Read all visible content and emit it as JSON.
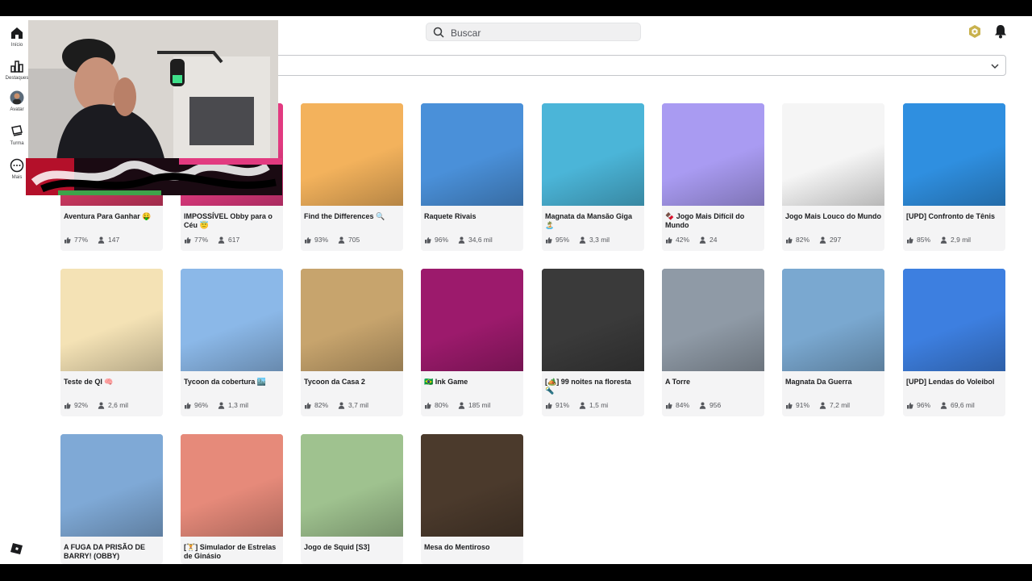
{
  "app": {
    "name": "Roblox"
  },
  "sidebar": {
    "items": [
      {
        "label": "Início",
        "icon": "home-icon"
      },
      {
        "label": "Destaques",
        "icon": "charts-icon"
      },
      {
        "label": "Avatar",
        "icon": "avatar-icon"
      },
      {
        "label": "Turma",
        "icon": "party-icon"
      },
      {
        "label": "Mais",
        "icon": "more-icon"
      }
    ]
  },
  "search": {
    "placeholder": "Buscar"
  },
  "header": {
    "robux_icon": "robux-icon",
    "notification_icon": "bell-icon"
  },
  "colors": {
    "background": "#ffffff",
    "card": "#f4f4f5",
    "text": "#1b1c1e",
    "muted": "#55575c"
  },
  "games": [
    {
      "title": "Aventura Para Ganhar 🤑",
      "rating": "77%",
      "players": "147",
      "thumb": "#d43a64"
    },
    {
      "title": "IMPOSSÍVEL Obby para o Céu 😇",
      "rating": "77%",
      "players": "617",
      "thumb": "#e23a80"
    },
    {
      "title": "Find the Differences 🔍",
      "rating": "93%",
      "players": "705",
      "thumb": "#f3b25c"
    },
    {
      "title": "Raquete Rivais",
      "rating": "96%",
      "players": "34,6 mil",
      "thumb": "#4a90d9"
    },
    {
      "title": "Magnata da Mansão Giga 🏝️",
      "rating": "95%",
      "players": "3,3 mil",
      "thumb": "#4bb5d8"
    },
    {
      "title": "🍫 Jogo Mais Difícil do Mundo",
      "rating": "42%",
      "players": "24",
      "thumb": "#a99bf2"
    },
    {
      "title": "Jogo Mais Louco do Mundo",
      "rating": "82%",
      "players": "297",
      "thumb": "#f5f5f5"
    },
    {
      "title": "[UPD] Confronto de Tênis",
      "rating": "85%",
      "players": "2,9 mil",
      "thumb": "#2f8fe0"
    },
    {
      "title": "Teste de QI 🧠",
      "rating": "92%",
      "players": "2,6 mil",
      "thumb": "#f4e2b5"
    },
    {
      "title": "Tycoon da cobertura 🏙️",
      "rating": "96%",
      "players": "1,3 mil",
      "thumb": "#8bb8e8"
    },
    {
      "title": "Tycoon da Casa 2",
      "rating": "82%",
      "players": "3,7 mil",
      "thumb": "#c7a46d"
    },
    {
      "title": "🇧🇷 Ink Game",
      "rating": "80%",
      "players": "185 mil",
      "thumb": "#9c1a6c"
    },
    {
      "title": "[🏕️] 99 noites na floresta 🔦",
      "rating": "91%",
      "players": "1,5 mi",
      "thumb": "#3a3a3a"
    },
    {
      "title": "A Torre",
      "rating": "84%",
      "players": "956",
      "thumb": "#8f9aa6"
    },
    {
      "title": "Magnata Da Guerra",
      "rating": "91%",
      "players": "7,2 mil",
      "thumb": "#7aa8d0"
    },
    {
      "title": "[UPD] Lendas do Voleibol",
      "rating": "96%",
      "players": "69,6 mil",
      "thumb": "#3d7fe0"
    },
    {
      "title": "A FUGA DA PRISÃO DE BARRY! (OBBY)",
      "rating": "",
      "players": "",
      "thumb": "#7fa9d6"
    },
    {
      "title": "[🏋️] Simulador de Estrelas de Ginásio",
      "rating": "",
      "players": "",
      "thumb": "#e68a7a"
    },
    {
      "title": "Jogo de Squid [S3]",
      "rating": "",
      "players": "",
      "thumb": "#9fc28f"
    },
    {
      "title": "Mesa do Mentiroso",
      "rating": "",
      "players": "",
      "thumb": "#4b3a2c"
    }
  ],
  "overlay": {
    "webcam": "webcam-overlay",
    "streamer_logo": "streamer-logo"
  }
}
